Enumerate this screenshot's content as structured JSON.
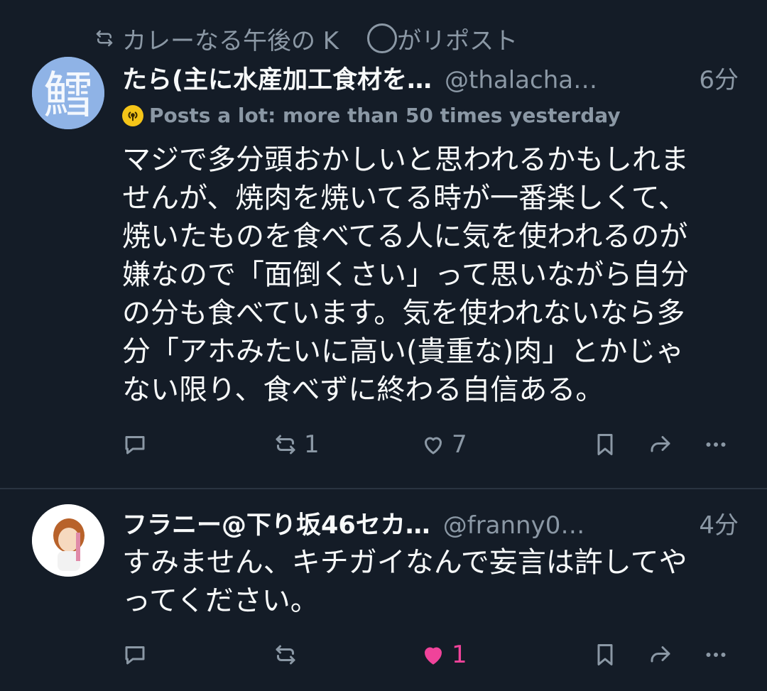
{
  "posts": [
    {
      "repost_by": "カレーなる午後の K",
      "repost_suffix": "がリポスト",
      "name": "たら(主に水産加工食材を…",
      "handle": "@thalacha…",
      "time": "6分",
      "badge": "Posts a lot: more than 50 times yesterday",
      "body_lines": [
        "マジで多分頭おかしいと思われるかもしれま",
        "せんが、焼肉を焼いてる時が一番楽しくて、",
        "焼いたものを食べてる人に気を使われるのが",
        "嫌なので「面倒くさい」って思いながら自分",
        "の分も食べています。気を使われないなら多",
        "分「アホみたいに高い(貴重な)肉」とかじゃ",
        "ない限り、食べずに終わる自信ある。"
      ],
      "avatar_glyph": "鱈",
      "reposts": "1",
      "likes": "7"
    },
    {
      "name": "フラニー@下り坂46セカ…",
      "handle": "@franny0…",
      "time": "4分",
      "body_lines": [
        "すみません、キチガイなんで妄言は許してや",
        "ってください。"
      ],
      "likes": "1"
    }
  ],
  "colors": {
    "background": "#141c27",
    "secondary_text": "#8b98a5",
    "like_pink": "#f0439a",
    "badge_yellow": "#f5c518"
  },
  "icons": [
    "repost-icon",
    "reply-icon",
    "like-icon",
    "bookmark-icon",
    "share-icon",
    "more-icon",
    "podcast-badge-icon"
  ]
}
